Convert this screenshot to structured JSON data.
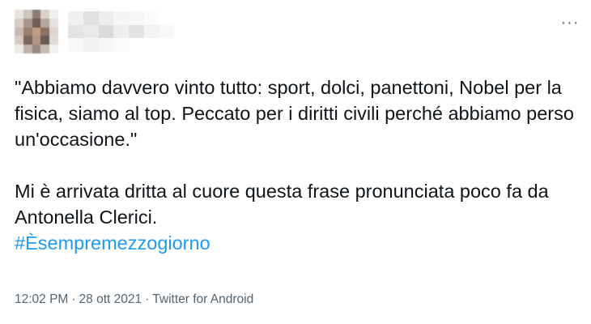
{
  "tweet": {
    "paragraph1": "\"Abbiamo davvero vinto tutto: sport, dolci, panettoni, Nobel per la fisica, siamo al top. Peccato per i diritti civili perché abbiamo perso un'occasione.\"",
    "paragraph2": "Mi è arrivata dritta al cuore questa frase pronunciata poco fa da Antonella Clerici.",
    "hashtag": "#Èsempremezzogiorno"
  },
  "meta": {
    "time": "12:02 PM",
    "separator1": "·",
    "date": "28 ott 2021",
    "separator2": "·",
    "source": "Twitter for Android"
  },
  "icons": {
    "more": "more-horizontal-icon"
  },
  "colors": {
    "text": "#0f1419",
    "secondary": "#536471",
    "link": "#1d9bf0"
  }
}
